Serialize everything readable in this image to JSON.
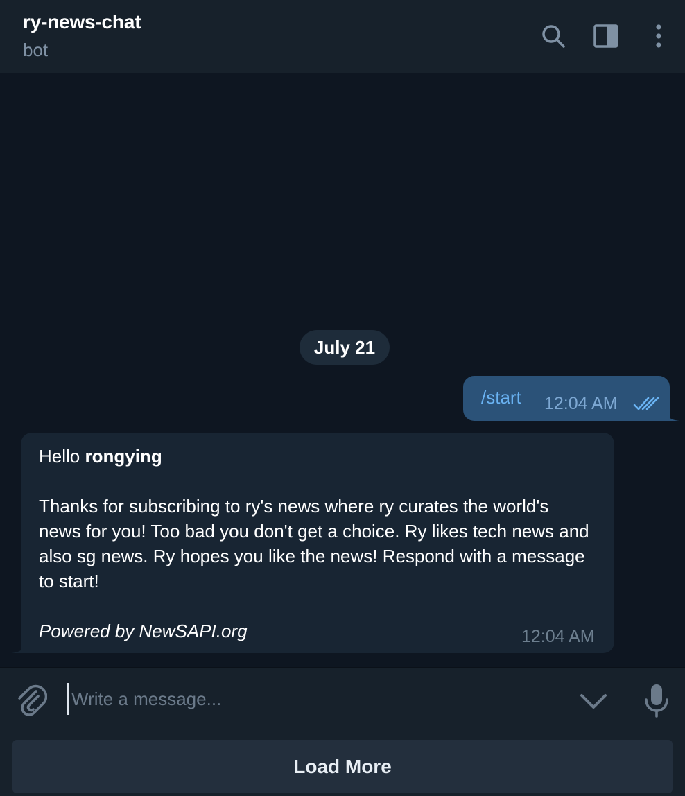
{
  "header": {
    "title": "ry-news-chat",
    "status": "bot",
    "icons": [
      "search-icon",
      "sidebar-toggle-icon",
      "more-vertical-icon"
    ]
  },
  "messages": {
    "date_separator": "July 21",
    "outgoing": {
      "text": "/start",
      "time": "12:04 AM",
      "status_icon": "double-check-icon"
    },
    "incoming": {
      "greeting": "Hello",
      "username": "rongying",
      "body": "Thanks for subscribing to ry's news where ry curates the world's news for you! Too bad you don't get a choice. Ry likes tech news and also sg news. Ry hopes you like the news! Respond with a message to start!",
      "footer": "Powered by NewSAPI.org",
      "time": "12:04 AM"
    }
  },
  "composer": {
    "placeholder": "Write a message...",
    "value": "",
    "load_more_label": "Load More",
    "icons": [
      "paperclip-icon",
      "chevron-down-icon",
      "microphone-icon"
    ]
  },
  "colors": {
    "background": "#0e1621",
    "header": "#17212b",
    "outgoing_bubble": "#2b5278",
    "incoming_bubble": "#182533",
    "accent": "#6ab3f3",
    "muted": "#7f91a4"
  }
}
